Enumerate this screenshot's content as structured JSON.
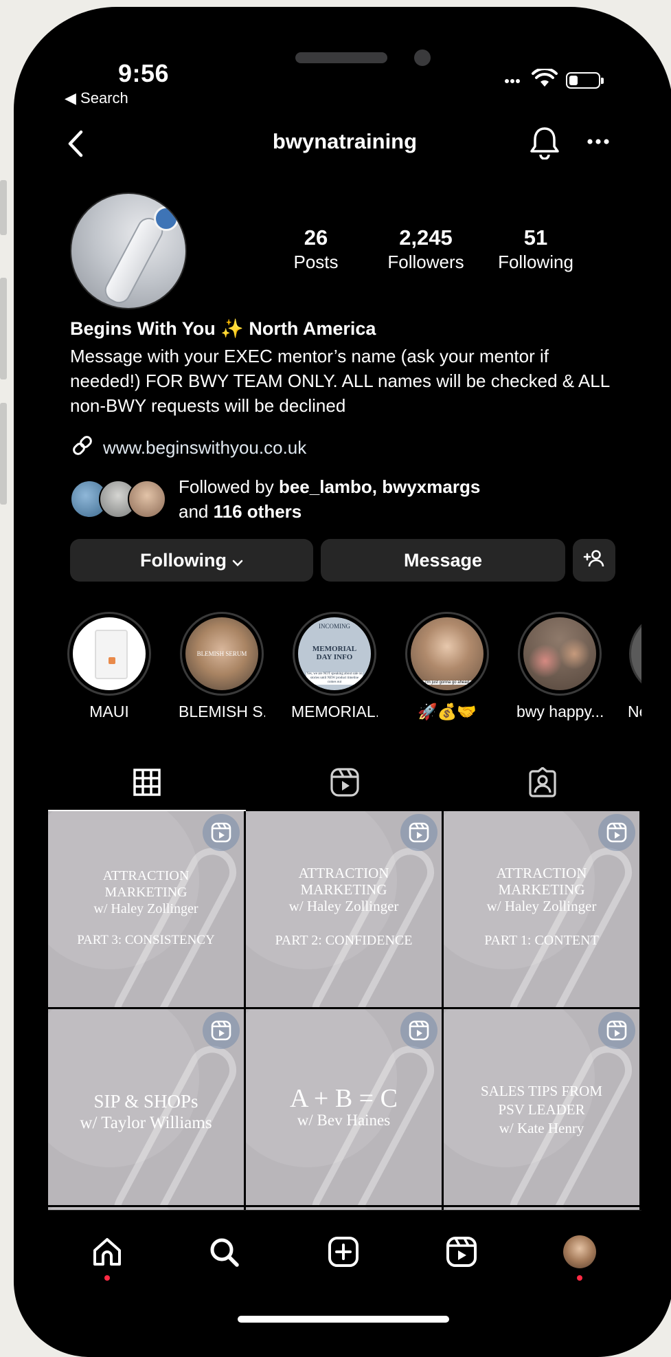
{
  "status": {
    "time": "9:56",
    "back_label": "◀ Search"
  },
  "header": {
    "username": "bwynatraining"
  },
  "stats": [
    {
      "value": "26",
      "label": "Posts"
    },
    {
      "value": "2,245",
      "label": "Followers"
    },
    {
      "value": "51",
      "label": "Following"
    }
  ],
  "bio": {
    "name": "Begins With You ✨ North America",
    "text": "Message with your EXEC mentor’s name (ask your mentor if needed!) FOR BWY TEAM ONLY. ALL names will be checked & ALL non-BWY requests will be declined",
    "link": "www.beginswithyou.co.uk"
  },
  "followed_by": {
    "prefix": "Followed by ",
    "names": "bee_lambo, bwyxmargs",
    "and": "and ",
    "others": "116 others"
  },
  "buttons": {
    "following": "Following",
    "message": "Message"
  },
  "highlights": [
    {
      "label": "MAUI",
      "img_text": ""
    },
    {
      "label": "BLEMISH S...",
      "img_text": "BLEMISH SERUM"
    },
    {
      "label": "MEMORIAL...",
      "img_text": "MEMORIAL DAY INFO",
      "img_top": "INCOMING",
      "img_bottom": "Yes, we are NOT speaking about sale on stories until NEW product timeline comes out"
    },
    {
      "label": "🚀💰🤝",
      "img_text": "I'm just gonna go ahead"
    },
    {
      "label": "bwy happy...",
      "img_text": ""
    },
    {
      "label": "Ne",
      "img_text": ""
    }
  ],
  "posts": [
    {
      "line1": "ATTRACTION",
      "line2": "MARKETING",
      "line3": "w/ Haley Zollinger",
      "line4": "PART 3: CONSISTENCY"
    },
    {
      "line1": "ATTRACTION",
      "line2": "MARKETING",
      "line3": "w/ Haley Zollinger",
      "line4": "PART 2: CONFIDENCE"
    },
    {
      "line1": "ATTRACTION",
      "line2": "MARKETING",
      "line3": "w/ Haley Zollinger",
      "line4": "PART 1: CONTENT"
    },
    {
      "line1": "SIP & SHOPs",
      "line2": "w/ Taylor Williams"
    },
    {
      "line1": "A + B = C",
      "line2": "w/ Bev Haines"
    },
    {
      "line1": "SALES TIPS FROM",
      "line2": "PSV LEADER",
      "line3": "w/ Kate Henry"
    }
  ],
  "colors": {
    "background": "#000000",
    "button": "#262626",
    "notification_dot": "#ff2a44"
  }
}
